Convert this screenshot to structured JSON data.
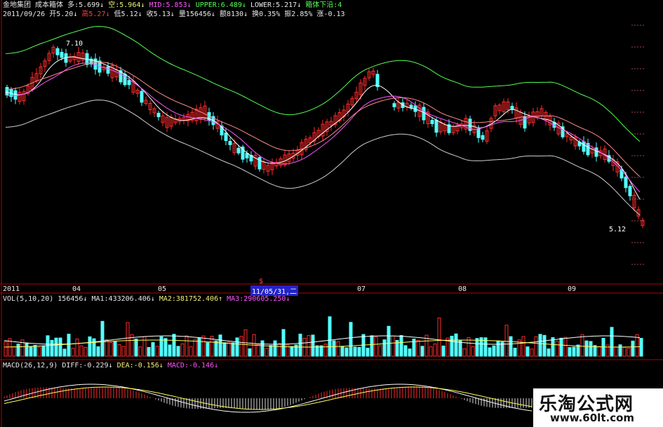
{
  "price_panel": {
    "title_line": {
      "name": "金地集团",
      "indicator": "成本箱体",
      "duo": "多:5.699↓",
      "kong": "空:5.964↓",
      "mid": "MID:5.853↓",
      "upper": "UPPER:6.489↓",
      "lower": "LOWER:5.217↓",
      "box_down": "箱体下沿:4"
    },
    "info_line": {
      "date": "2011/09/26",
      "open": "开5.20↓",
      "high": "高5.27↓",
      "low": "低5.12↓",
      "close": "收5.13↓",
      "volume": "量156456↓",
      "amount": "额8130↓",
      "turnover": "换0.35%",
      "amplitude": "振2.85%",
      "change": "涨-0.13"
    },
    "high_label": "7.10",
    "low_label": "5.12"
  },
  "time_axis": {
    "labels": [
      "2011",
      "04",
      "05",
      "07",
      "08",
      "09"
    ],
    "cursor_label": "11/05/31,二",
    "marker": "$"
  },
  "volume_panel": {
    "name": "VOL(5,10,20)",
    "vol": "156456↓",
    "ma1": "MA1:433206.406↓",
    "ma2": "MA2:381752.406↑",
    "ma3": "MA3:290605.250↓"
  },
  "macd_panel": {
    "name": "MACD(26,12,9)",
    "diff": "DIFF:-0.229↓",
    "dea": "DEA:-0.156↓",
    "macd": "MACD:-0.146↓"
  },
  "watermark": {
    "title": "乐淘公式网",
    "url": "www.60lt.com"
  },
  "colors": {
    "up": "#ff2a2a",
    "down": "#54ffff",
    "frame": "#b80000",
    "ma_white": "#ffffff",
    "ma_yellow": "#ffff55",
    "ma_magenta": "#ff55ff",
    "ma_green": "#55ff55"
  }
}
